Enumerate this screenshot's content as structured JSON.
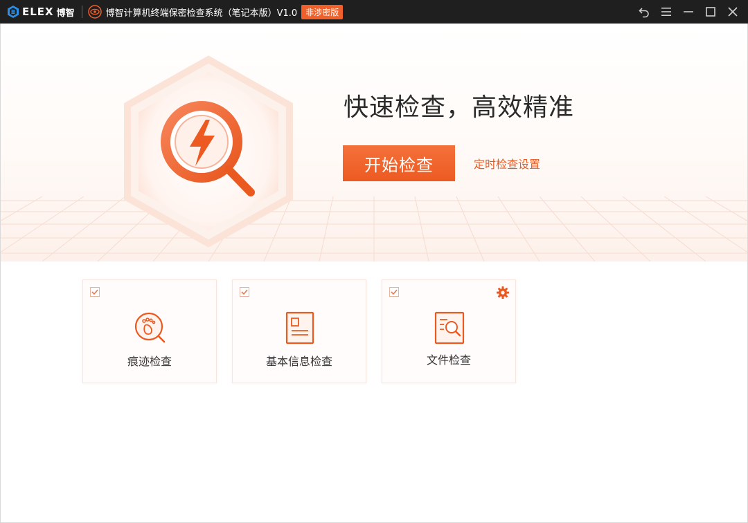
{
  "titlebar": {
    "logo_text": "ELEX",
    "logo_cn": "博智",
    "app_title": "博智计算机终端保密检查系统（笔记本版）V1.0",
    "mode_badge": "非涉密版",
    "controls": [
      "back-icon",
      "menu-icon",
      "minimize-icon",
      "maximize-icon",
      "close-icon"
    ]
  },
  "hero": {
    "title": "快速检查，高效精准",
    "start_button": "开始检查",
    "schedule_link": "定时检查设置"
  },
  "cards": [
    {
      "label": "痕迹检查",
      "checked": true,
      "icon": "footprint-search-icon",
      "has_settings": false
    },
    {
      "label": "基本信息检查",
      "checked": true,
      "icon": "info-card-icon",
      "has_settings": false
    },
    {
      "label": "文件检查",
      "checked": true,
      "icon": "document-search-icon",
      "has_settings": true
    }
  ],
  "colors": {
    "accent": "#ec5a22",
    "titlebar_bg": "#1f1f1f",
    "text_dark": "#2b2b2b"
  }
}
